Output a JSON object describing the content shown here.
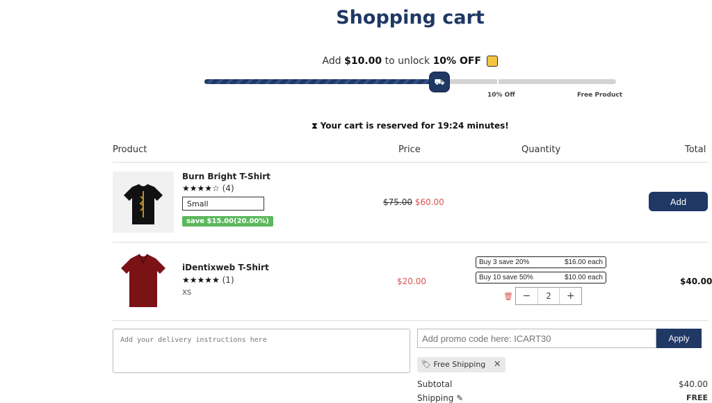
{
  "title": "Shopping cart",
  "progress": {
    "prefix": "Add",
    "amount": "$10.00",
    "mid": "to unlock",
    "reward": "10% OFF",
    "fraction": 0.575,
    "milestones": [
      "10% Off",
      "Free Product"
    ]
  },
  "reserved": {
    "text": "Your cart is reserved for 19:24 minutes!"
  },
  "table_headers": {
    "product": "Product",
    "price": "Price",
    "quantity": "Quantity",
    "total": "Total"
  },
  "items": [
    {
      "name": "Burn Bright T-Shirt",
      "stars": "★★★★☆",
      "rating_count": "(4)",
      "variant": "Small",
      "save_badge": "save $15.00(20.00%)",
      "old_price": "$75.00",
      "price": "$60.00",
      "action": "Add"
    },
    {
      "name": "iDentixweb T-Shirt",
      "stars": "★★★★★",
      "rating_count": "(1)",
      "variant": "XS",
      "price": "$20.00",
      "tiers": [
        {
          "label": "Buy 3 save 20%",
          "each": "$16.00 each"
        },
        {
          "label": "Buy 10 save 50%",
          "each": "$10.00 each"
        }
      ],
      "quantity": "2",
      "total": "$40.00"
    }
  ],
  "delivery_placeholder": "Add your delivery instructions here",
  "promo": {
    "placeholder": "Add promo code here: ICART30",
    "apply": "Apply",
    "chip": "Free Shipping"
  },
  "summary": {
    "subtotal_label": "Subtotal",
    "subtotal": "$40.00",
    "shipping_label": "Shipping",
    "shipping": "FREE"
  }
}
